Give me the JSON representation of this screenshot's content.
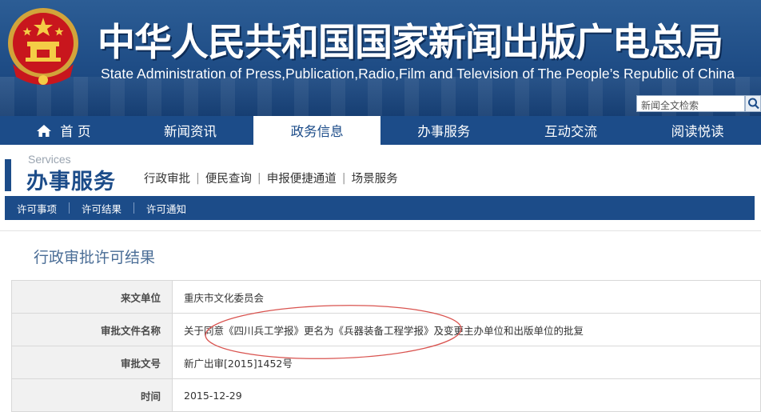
{
  "header": {
    "title_cn": "中华人民共和国国家新闻出版广电总局",
    "title_en": "State Administration of Press,Publication,Radio,Film and Television of The People’s Republic of China",
    "search_placeholder": "新闻全文检索",
    "emblem_icon": "national-emblem-icon",
    "search_icon": "search-icon"
  },
  "nav": {
    "items": [
      {
        "label": "首 页",
        "icon": "home-icon"
      },
      {
        "label": "新闻资讯"
      },
      {
        "label": "政务信息"
      },
      {
        "label": "办事服务",
        "active": true
      },
      {
        "label": "互动交流"
      },
      {
        "label": "阅读悦读"
      }
    ]
  },
  "section": {
    "en": "Services",
    "cn": "办事服务",
    "links": [
      "行政审批",
      "便民查询",
      "申报便捷通道",
      "场景服务"
    ],
    "link_sep": "|"
  },
  "tabs": [
    "许可事项",
    "许可结果",
    "许可通知"
  ],
  "page": {
    "title": "行政审批许可结果"
  },
  "table": {
    "rows": [
      {
        "label": "来文单位",
        "value": "重庆市文化委员会"
      },
      {
        "label": "审批文件名称",
        "value": "关于同意《四川兵工学报》更名为《兵器装备工程学报》及变更主办单位和出版单位的批复"
      },
      {
        "label": "审批文号",
        "value": "新广出审[2015]1452号"
      },
      {
        "label": "时间",
        "value": "2015-12-29"
      }
    ]
  },
  "colors": {
    "primary": "#1c4c89",
    "annotation": "#d9534f"
  }
}
